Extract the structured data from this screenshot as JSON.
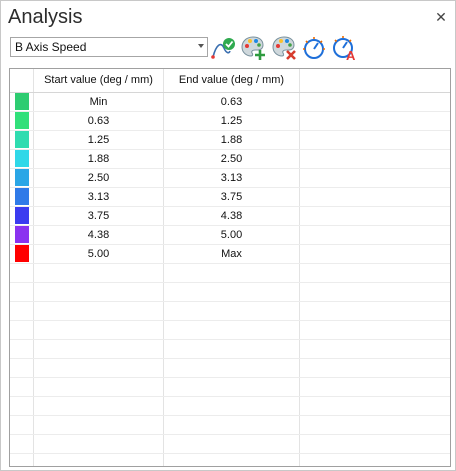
{
  "title": "Analysis",
  "close_glyph": "✕",
  "toolbar": {
    "select_value": "B Axis Speed",
    "buttons": [
      {
        "name": "apply-curve-icon",
        "color": "#1aa14a"
      },
      {
        "name": "palette-add-icon",
        "color": "#1aa14a"
      },
      {
        "name": "palette-remove-icon",
        "color": "#d63b2c"
      },
      {
        "name": "dial-icon",
        "color": "#1e88e5"
      },
      {
        "name": "dial-auto-icon",
        "color": "#e53935"
      }
    ]
  },
  "table": {
    "headers": [
      "Start value (deg / mm)",
      "End value (deg / mm)"
    ],
    "rows": [
      {
        "color": "#2ecc71",
        "start": "Min",
        "end": "0.63"
      },
      {
        "color": "#31e07a",
        "start": "0.63",
        "end": "1.25"
      },
      {
        "color": "#2fdcb0",
        "start": "1.25",
        "end": "1.88"
      },
      {
        "color": "#2fd8e8",
        "start": "1.88",
        "end": "2.50"
      },
      {
        "color": "#2aa6e6",
        "start": "2.50",
        "end": "3.13"
      },
      {
        "color": "#2f7ae8",
        "start": "3.13",
        "end": "3.75"
      },
      {
        "color": "#3b3bf0",
        "start": "3.75",
        "end": "4.38"
      },
      {
        "color": "#8a32f0",
        "start": "4.38",
        "end": "5.00"
      },
      {
        "color": "#ff0000",
        "start": "5.00",
        "end": "Max"
      }
    ]
  }
}
